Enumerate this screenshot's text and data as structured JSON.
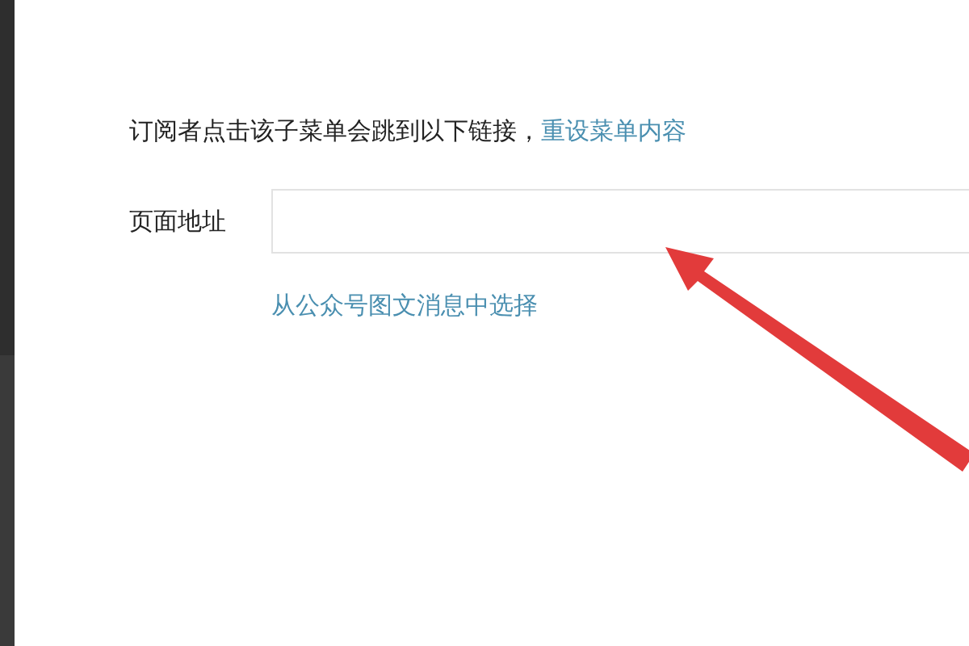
{
  "description": {
    "text": "订阅者点击该子菜单会跳到以下链接，",
    "link": "重设菜单内容"
  },
  "url_field": {
    "label": "页面地址"
  },
  "select_link": "从公众号图文消息中选择",
  "annotations": [
    {
      "kind": "arrow",
      "color": "#e23b3b"
    }
  ]
}
